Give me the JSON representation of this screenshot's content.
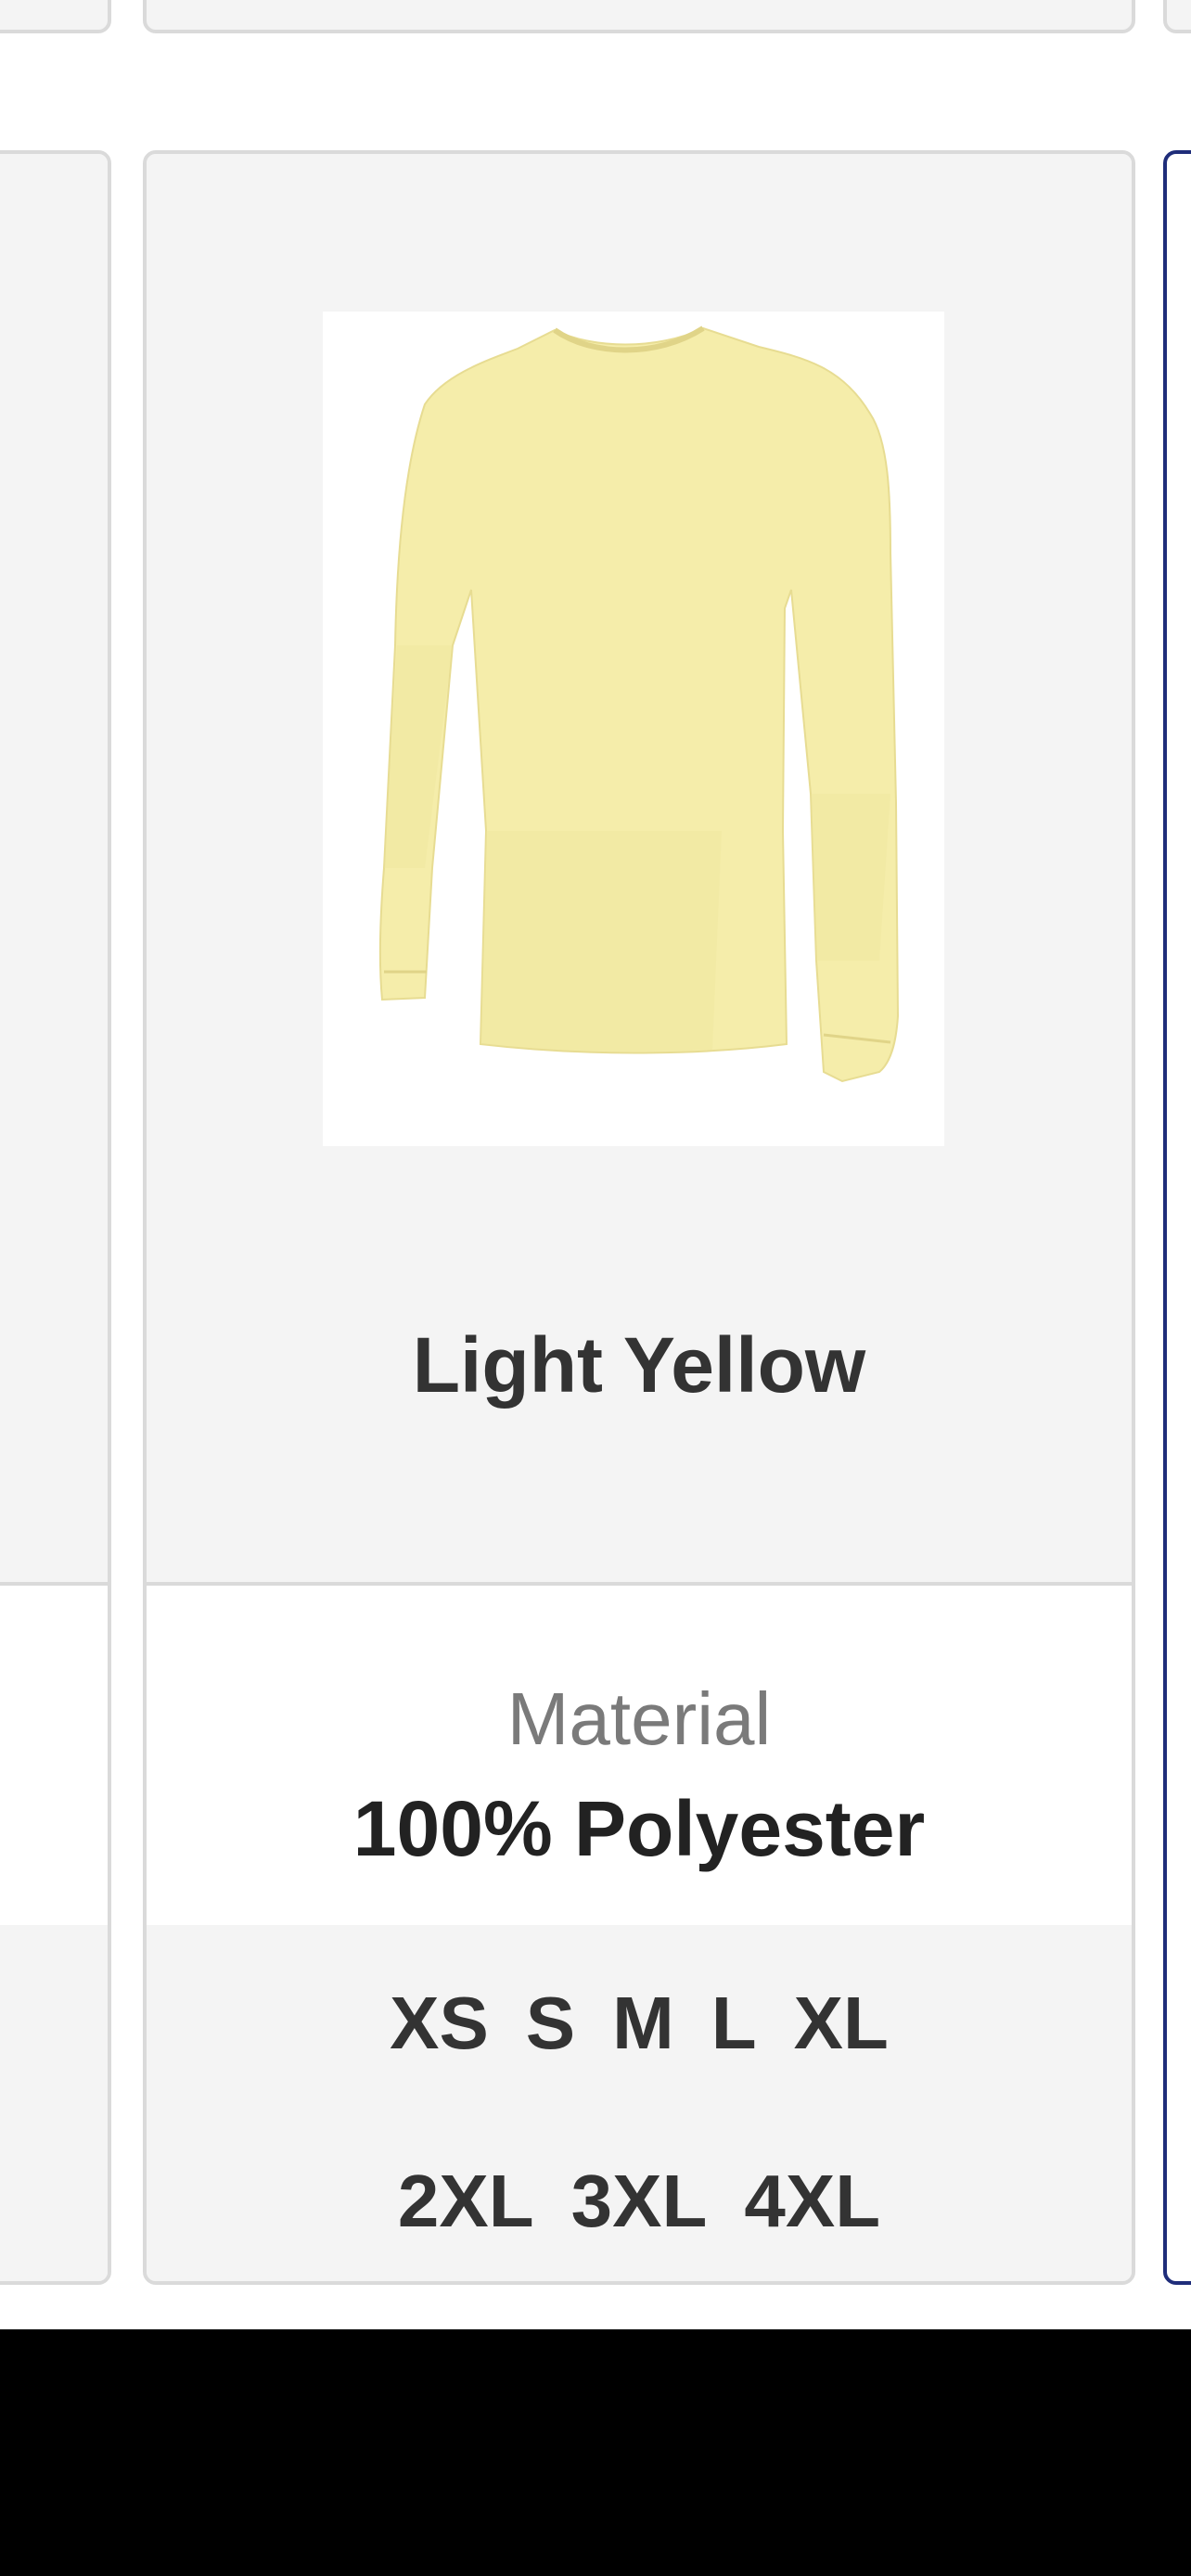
{
  "product": {
    "color_name": "Light Yellow",
    "shirt_color": "#F5EDAA",
    "material_label": "Material",
    "material_value": "100% Polyester",
    "sizes_row_1": [
      "XS",
      "S",
      "M",
      "L",
      "XL"
    ],
    "sizes_row_2": [
      "2XL",
      "3XL",
      "4XL"
    ]
  },
  "colors": {
    "card_border": "#dadada",
    "card_bg": "#f4f4f4",
    "selected_border": "#1f2d7a",
    "text_dark": "#333333",
    "text_muted": "#7a7a7a"
  }
}
